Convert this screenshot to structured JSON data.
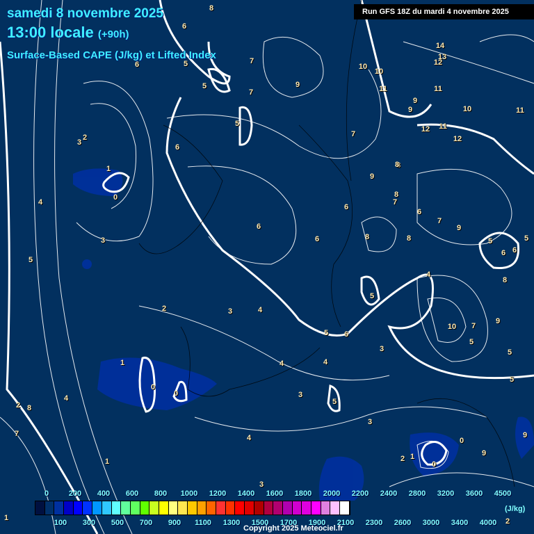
{
  "header": {
    "date": "samedi 8 novembre 2025",
    "time": "13:00 locale",
    "lead": "(+90h)",
    "product": "Surface-Based CAPE (J/kg) et Lifted Index",
    "run": "Run GFS 18Z du mardi 4 novembre 2025"
  },
  "legend": {
    "unit": "(J/kg)",
    "top_labels": [
      "0",
      "200",
      "400",
      "600",
      "800",
      "1000",
      "1200",
      "1400",
      "1600",
      "1800",
      "2000",
      "2200",
      "2400",
      "2800",
      "3200",
      "3600",
      "4500"
    ],
    "bottom_labels": [
      "100",
      "300",
      "500",
      "700",
      "900",
      "1100",
      "1300",
      "1500",
      "1700",
      "1900",
      "2100",
      "2300",
      "2600",
      "3000",
      "3400",
      "4000"
    ],
    "colors": [
      "#001040",
      "#00306a",
      "#0030a0",
      "#0000c8",
      "#0000ff",
      "#0032ff",
      "#0096ff",
      "#30c8ff",
      "#60ffff",
      "#60ff9c",
      "#60ff60",
      "#60ff00",
      "#c8ff20",
      "#ffff00",
      "#ffff80",
      "#ffe650",
      "#ffc800",
      "#ffa000",
      "#ff6400",
      "#ff3232",
      "#ff3200",
      "#ff0000",
      "#e00000",
      "#b00000",
      "#b00040",
      "#b00070",
      "#b000b0",
      "#d000d0",
      "#e000e0",
      "#ff00ff",
      "#e080e0",
      "#ffc0ff",
      "#ffffff"
    ]
  },
  "lifted_index_labels": [
    "8",
    "6",
    "5",
    "6",
    "7",
    "5",
    "7",
    "9",
    "5",
    "8",
    "14",
    "13",
    "12",
    "10",
    "10",
    "11",
    "11",
    "10",
    "11",
    "12",
    "11",
    "12",
    "9",
    "9",
    "7",
    "8",
    "9",
    "8",
    "7",
    "6",
    "6",
    "2",
    "3",
    "1",
    "0",
    "4",
    "3",
    "5",
    "6",
    "2",
    "3",
    "4",
    "5",
    "4",
    "6",
    "8",
    "6",
    "5",
    "8",
    "6",
    "7",
    "9",
    "5",
    "6",
    "5",
    "8",
    "10",
    "7",
    "5",
    "9",
    "5",
    "6",
    "5",
    "4",
    "1",
    "0",
    "0",
    "4",
    "3",
    "4",
    "3",
    "5",
    "3",
    "4",
    "3",
    "2",
    "1",
    "0",
    "1",
    "2",
    "8",
    "7",
    "9",
    "1",
    "9",
    "0",
    "2"
  ],
  "copyright": "Copyright 2025 Meteociel.fr"
}
